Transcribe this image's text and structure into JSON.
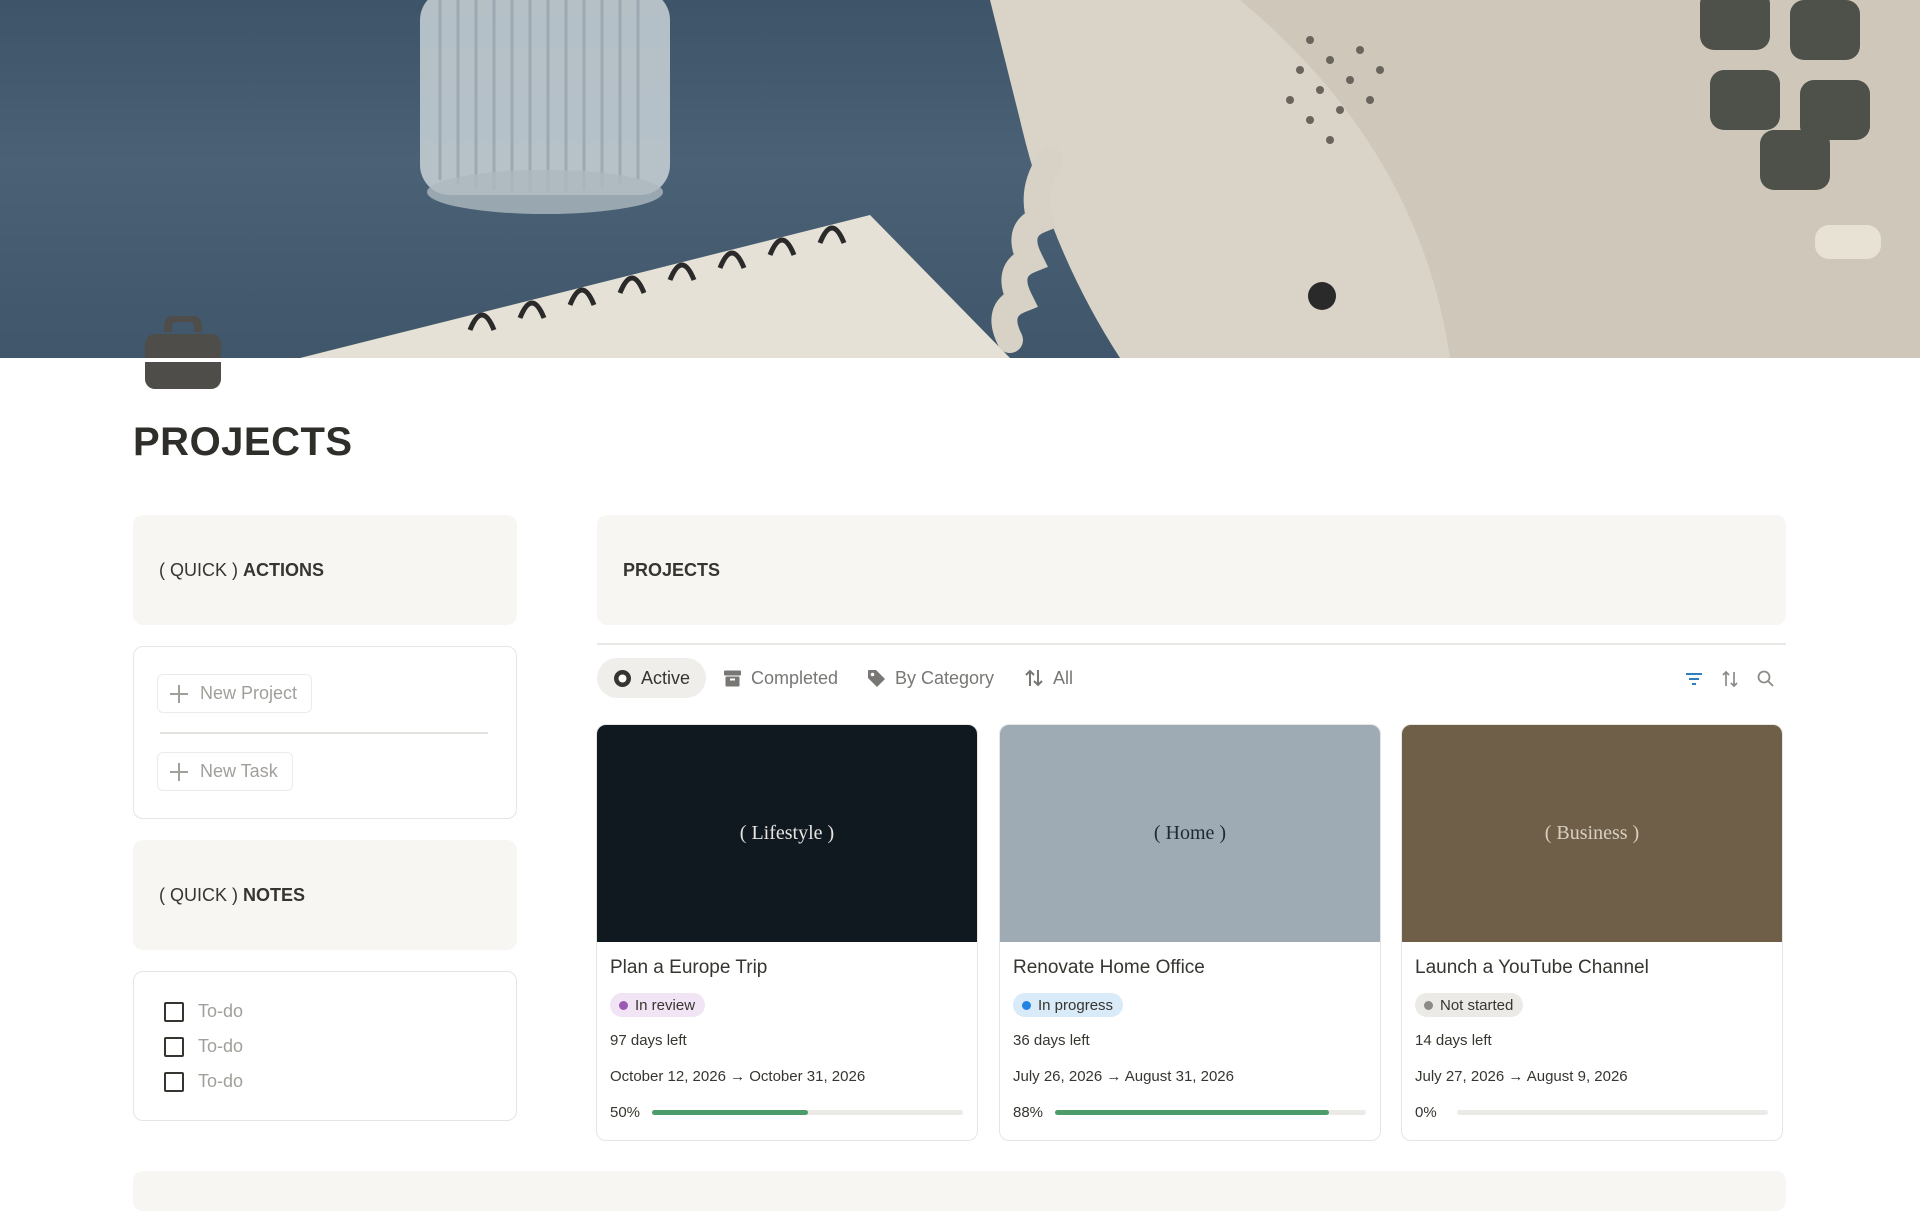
{
  "page": {
    "title": "PROJECTS",
    "icon": "briefcase-icon"
  },
  "quick_actions": {
    "prefix": "( QUICK )",
    "bold": "ACTIONS",
    "buttons": [
      {
        "label": "New Project",
        "icon": "plus-icon"
      },
      {
        "label": "New Task",
        "icon": "plus-icon"
      }
    ]
  },
  "quick_notes": {
    "prefix": "( QUICK )",
    "bold": "NOTES",
    "todos": [
      {
        "label": "To-do",
        "checked": false
      },
      {
        "label": "To-do",
        "checked": false
      },
      {
        "label": "To-do",
        "checked": false
      }
    ]
  },
  "projects": {
    "heading": "PROJECTS",
    "tabs": [
      {
        "label": "Active",
        "icon": "circle-dot-icon",
        "active": true
      },
      {
        "label": "Completed",
        "icon": "archive-icon",
        "active": false
      },
      {
        "label": "By Category",
        "icon": "tag-icon",
        "active": false
      },
      {
        "label": "All",
        "icon": "sort-arrows-icon",
        "active": false
      }
    ],
    "toolbar": [
      "filter-icon",
      "sort-icon",
      "search-icon"
    ],
    "accent": "#2f7ec2",
    "cards": [
      {
        "category": "( Lifestyle )",
        "cover_color": "#101820",
        "category_color": "#e6e4df",
        "title": "Plan a Europe Trip",
        "status": "In review",
        "status_bg": "#f1e4f5",
        "status_dot": "#9b59b6",
        "days_left": "97 days left",
        "dates": "October 12, 2026 → October 31, 2026",
        "progress_label": "50%",
        "progress": 0.5
      },
      {
        "category": "( Home )",
        "cover_color": "#9eaab4",
        "category_color": "#1f2a33",
        "title": "Renovate Home Office",
        "status": "In progress",
        "status_bg": "#d9eaf8",
        "status_dot": "#2383e2",
        "days_left": "36 days left",
        "dates": "July 26, 2026 → August 31, 2026",
        "progress_label": "88%",
        "progress": 0.88
      },
      {
        "category": "( Business )",
        "cover_color": "#6f5f49",
        "category_color": "#d8cfc0",
        "title": "Launch a YouTube Channel",
        "status": "Not started",
        "status_bg": "#ebeae7",
        "status_dot": "#8d8b86",
        "days_left": "14 days left",
        "dates": "July 27, 2026 → August 9, 2026",
        "progress_label": "0%",
        "progress": 0
      }
    ]
  }
}
